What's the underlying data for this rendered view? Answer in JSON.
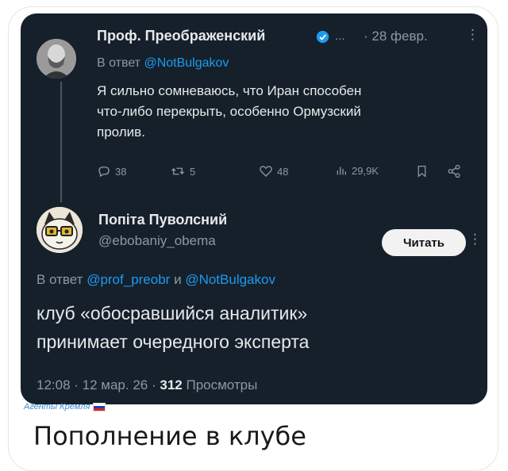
{
  "tweet1": {
    "author": "Проф. Преображенский",
    "dots": "...",
    "date": "· 28 февр.",
    "reply_prefix": "В ответ",
    "reply_to": "@NotBulgakov",
    "text_line1": "Я сильно сомневаюсь, что Иран способен",
    "text_line2": "что-либо перекрыть, особенно Ормузский",
    "text_line3": "пролив.",
    "replies": "38",
    "reposts": "5",
    "likes": "48",
    "views": "29,9K"
  },
  "tweet2": {
    "author": "Попіта Пуволсний",
    "handle": "@ebobaniy_obema",
    "follow_label": "Читать",
    "reply_prefix": "В ответ",
    "reply_to_1": "@prof_preobr",
    "reply_and": "и",
    "reply_to_2": "@NotBulgakov",
    "text_line1": "клуб «обосравшийся аналитик»",
    "text_line2": "принимает очередного эксперта",
    "time": "12:08 · 12 мар. 26 ·",
    "views_count": "312",
    "views_label": "Просмотры"
  },
  "watermark": "Агенты Кремля",
  "caption": "Пополнение в клубе",
  "colors": {
    "background": "#15202b",
    "link": "#1d9bf0",
    "muted": "#8b98a5",
    "text": "#e7e9ea"
  }
}
